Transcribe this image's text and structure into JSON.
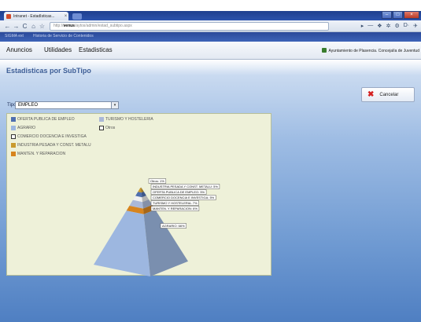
{
  "browser": {
    "tab_title": "Intranet - EstadÍsticas...",
    "tab_close": "×",
    "window_buttons": [
      "–",
      "□",
      "×"
    ],
    "nav_icons": [
      "←",
      "→",
      "C",
      "⌂",
      "☆"
    ],
    "url_prefix": "http://",
    "url_host": "venus",
    "url_rest": "/aytos/admin/estad_subtipo.aspx",
    "right_icons": [
      "▸",
      "—",
      "❖",
      "✲",
      "⚙",
      "D·",
      "✈"
    ]
  },
  "bookmarks": [
    "SIGMA ext",
    "Historia de Servicio de Contenidos"
  ],
  "menu": [
    "Anuncios",
    "Utilidades",
    "Estadisticas"
  ],
  "org": "Ayuntamiento de Plasencia. Concejalía de Juventud",
  "page": {
    "title": "Estadisticas por SubTipo",
    "cancel_label": "Cancelar",
    "tipo_label": "Tipo:",
    "tipo_value": "EMPLEO",
    "dropdown_arrow": "▾"
  },
  "legend": [
    {
      "label": "OFERTA PUBLICA DE EMPLEO",
      "color": "#4f6fae"
    },
    {
      "label": "AGRARIO",
      "color": "#9db7e0"
    },
    {
      "label": "COMERCIO DOCENCIA E INVESTIGA",
      "color": "#ffffff"
    },
    {
      "label": "INDUSTRIA PESADA Y CONST. METALU",
      "color": "#c99a2e"
    },
    {
      "label": "MANTEN. Y REPARACION",
      "color": "#d7841e"
    },
    {
      "label": "TURISMO Y HOSTELERIA",
      "color": "#aab8d8"
    },
    {
      "label": "Otros",
      "color": "#ffffff"
    }
  ],
  "chart_data": {
    "type": "pie",
    "style": "pyramid",
    "slices": [
      {
        "label": "AGRARIO",
        "value": 66
      },
      {
        "label": "MANTEN. Y REPARACION",
        "value": 6
      },
      {
        "label": "TURISMO Y HOSTELERIA",
        "value": 7
      },
      {
        "label": "COMERCIO DOCENCIA E INVESTIGA",
        "value": 5
      },
      {
        "label": "OFERTA PUBLICA DE EMPLEO",
        "value": 5
      },
      {
        "label": "INDUSTRIA PESADA Y CONST. METALU",
        "value": 5
      },
      {
        "label": "Otros",
        "value": 1
      }
    ],
    "data_labels": [
      "Otros: 1%",
      "INDUSTRIA PESADA Y CONST. METALU: 5%",
      "OFERTA PUBLICA DE EMPLEO: 5%",
      "COMERCIO DOCENCIA E INVESTIGA: 5%",
      "TURISMO Y HOSTELERIA: 7%",
      "MANTEN. Y REPARACION: 6%",
      "AGRARIO: 66%"
    ]
  }
}
